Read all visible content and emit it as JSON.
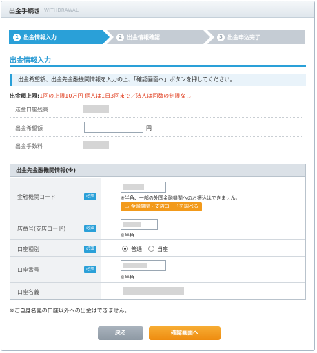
{
  "window": {
    "title_jp": "出金手続き",
    "title_en": "WITHDRAWAL"
  },
  "steps": [
    {
      "num": "1",
      "label": "出金情報入力",
      "active": true
    },
    {
      "num": "2",
      "label": "出金情報確認",
      "active": false
    },
    {
      "num": "3",
      "label": "出金申込完了",
      "active": false
    }
  ],
  "section_title": "出金情報入力",
  "notice": "出金希望額、出金先金融機関情報を入力の上、「確認画面へ」ボタンを押してください。",
  "limit": {
    "label": "出金額上限:",
    "text": "1回の上限10万円 個人は1日3回まで／法人は回数の制限なし"
  },
  "fields": {
    "balance_label": "送金口座残高",
    "amount_label": "出金希望額",
    "amount_value": "",
    "yen": "円",
    "fee_label": "出金手数料"
  },
  "bank": {
    "header": "出金先金融機関情報(※)",
    "required": "必須",
    "code_label": "金融機関コード",
    "code_note": "※半角、一部の外国金融機関へのお振込はできません。",
    "lookup_button": "金融機関・支店コードを調べる",
    "branch_label": "店番号(支店コード)",
    "branch_note": "※半角",
    "type_label": "口座種別",
    "type_options": [
      "普通",
      "当座"
    ],
    "type_selected": "普通",
    "number_label": "口座番号",
    "number_note": "※半角",
    "name_label": "口座名義"
  },
  "footer_note": "※ご自身名義の口座以外への出金はできません。",
  "buttons": {
    "back": "戻る",
    "confirm": "確認画面へ"
  },
  "colors": {
    "accent": "#2aa0d8",
    "warning": "#e03c1d",
    "confirm": "#ee8c10",
    "back": "#8e99a4"
  }
}
